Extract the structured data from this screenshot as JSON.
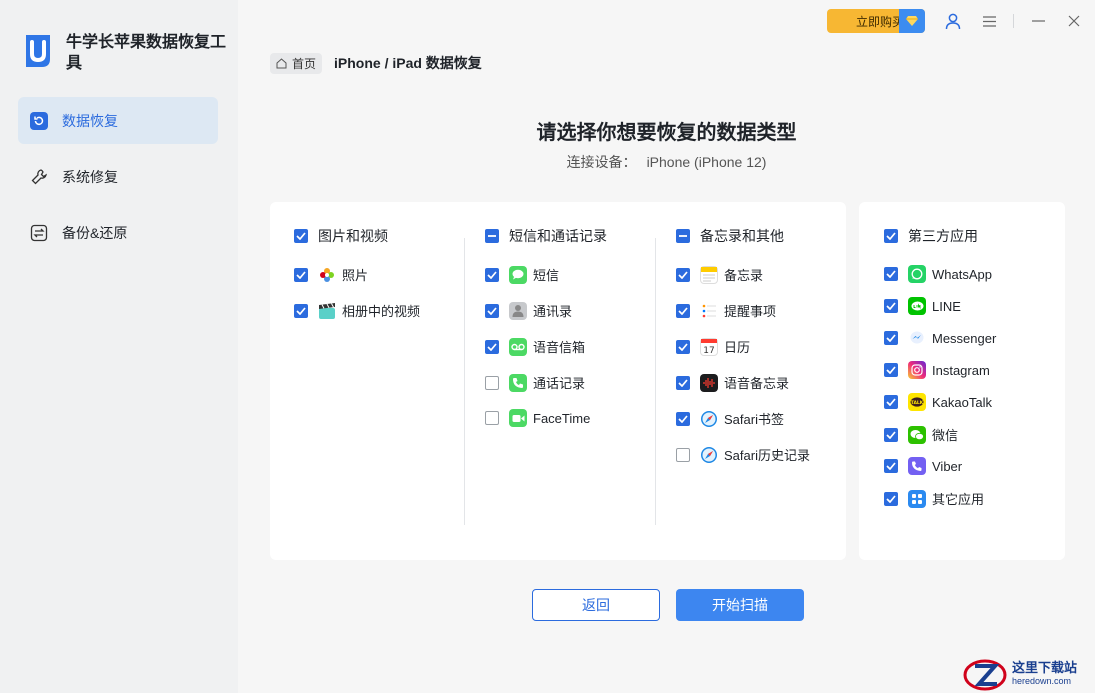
{
  "app": {
    "title": "牛学长苹果数据恢复工具"
  },
  "sidebar": {
    "items": [
      {
        "label": "数据恢复",
        "icon": "restore-icon",
        "active": true
      },
      {
        "label": "系统修复",
        "icon": "wrench-icon",
        "active": false
      },
      {
        "label": "备份&还原",
        "icon": "backup-icon",
        "active": false
      }
    ]
  },
  "topbar": {
    "buy_label": "立即购买"
  },
  "breadcrumb": {
    "home": "首页",
    "current": "iPhone / iPad 数据恢复"
  },
  "main": {
    "title": "请选择你想要恢复的数据类型",
    "device_label": "连接设备：",
    "device_name": "iPhone (iPhone 12)"
  },
  "columns": [
    {
      "header": "图片和视频",
      "state": "checked",
      "items": [
        {
          "label": "照片",
          "checked": true,
          "icon": "photos-icon"
        },
        {
          "label": "相册中的视频",
          "checked": true,
          "icon": "clapper-icon"
        }
      ]
    },
    {
      "header": "短信和通话记录",
      "state": "partial",
      "items": [
        {
          "label": "短信",
          "checked": true,
          "icon": "messages-icon"
        },
        {
          "label": "通讯录",
          "checked": true,
          "icon": "contacts-icon"
        },
        {
          "label": "语音信箱",
          "checked": true,
          "icon": "voicemail-icon"
        },
        {
          "label": "通话记录",
          "checked": false,
          "icon": "phone-icon"
        },
        {
          "label": "FaceTime",
          "checked": false,
          "icon": "facetime-icon"
        }
      ]
    },
    {
      "header": "备忘录和其他",
      "state": "partial",
      "items": [
        {
          "label": "备忘录",
          "checked": true,
          "icon": "notes-icon"
        },
        {
          "label": "提醒事项",
          "checked": true,
          "icon": "reminders-icon"
        },
        {
          "label": "日历",
          "checked": true,
          "icon": "calendar-icon"
        },
        {
          "label": "语音备忘录",
          "checked": true,
          "icon": "voice-memo-icon"
        },
        {
          "label": "Safari书签",
          "checked": true,
          "icon": "safari-icon"
        },
        {
          "label": "Safari历史记录",
          "checked": false,
          "icon": "safari-icon"
        }
      ]
    },
    {
      "header": "第三方应用",
      "state": "checked",
      "items": [
        {
          "label": "WhatsApp",
          "checked": true,
          "icon": "whatsapp-icon"
        },
        {
          "label": "LINE",
          "checked": true,
          "icon": "line-icon"
        },
        {
          "label": "Messenger",
          "checked": true,
          "icon": "messenger-icon"
        },
        {
          "label": "Instagram",
          "checked": true,
          "icon": "instagram-icon"
        },
        {
          "label": "KakaoTalk",
          "checked": true,
          "icon": "kakaotalk-icon"
        },
        {
          "label": "微信",
          "checked": true,
          "icon": "wechat-icon"
        },
        {
          "label": "Viber",
          "checked": true,
          "icon": "viber-icon"
        },
        {
          "label": "其它应用",
          "checked": true,
          "icon": "other-apps-icon"
        }
      ]
    }
  ],
  "buttons": {
    "back": "返回",
    "scan": "开始扫描"
  },
  "watermark": {
    "cn": "这里下载站",
    "en": "heredown.com"
  },
  "colors": {
    "accent": "#2b6bde",
    "buy": "#f7b733",
    "sidebar_active_bg": "#dde8f3"
  }
}
